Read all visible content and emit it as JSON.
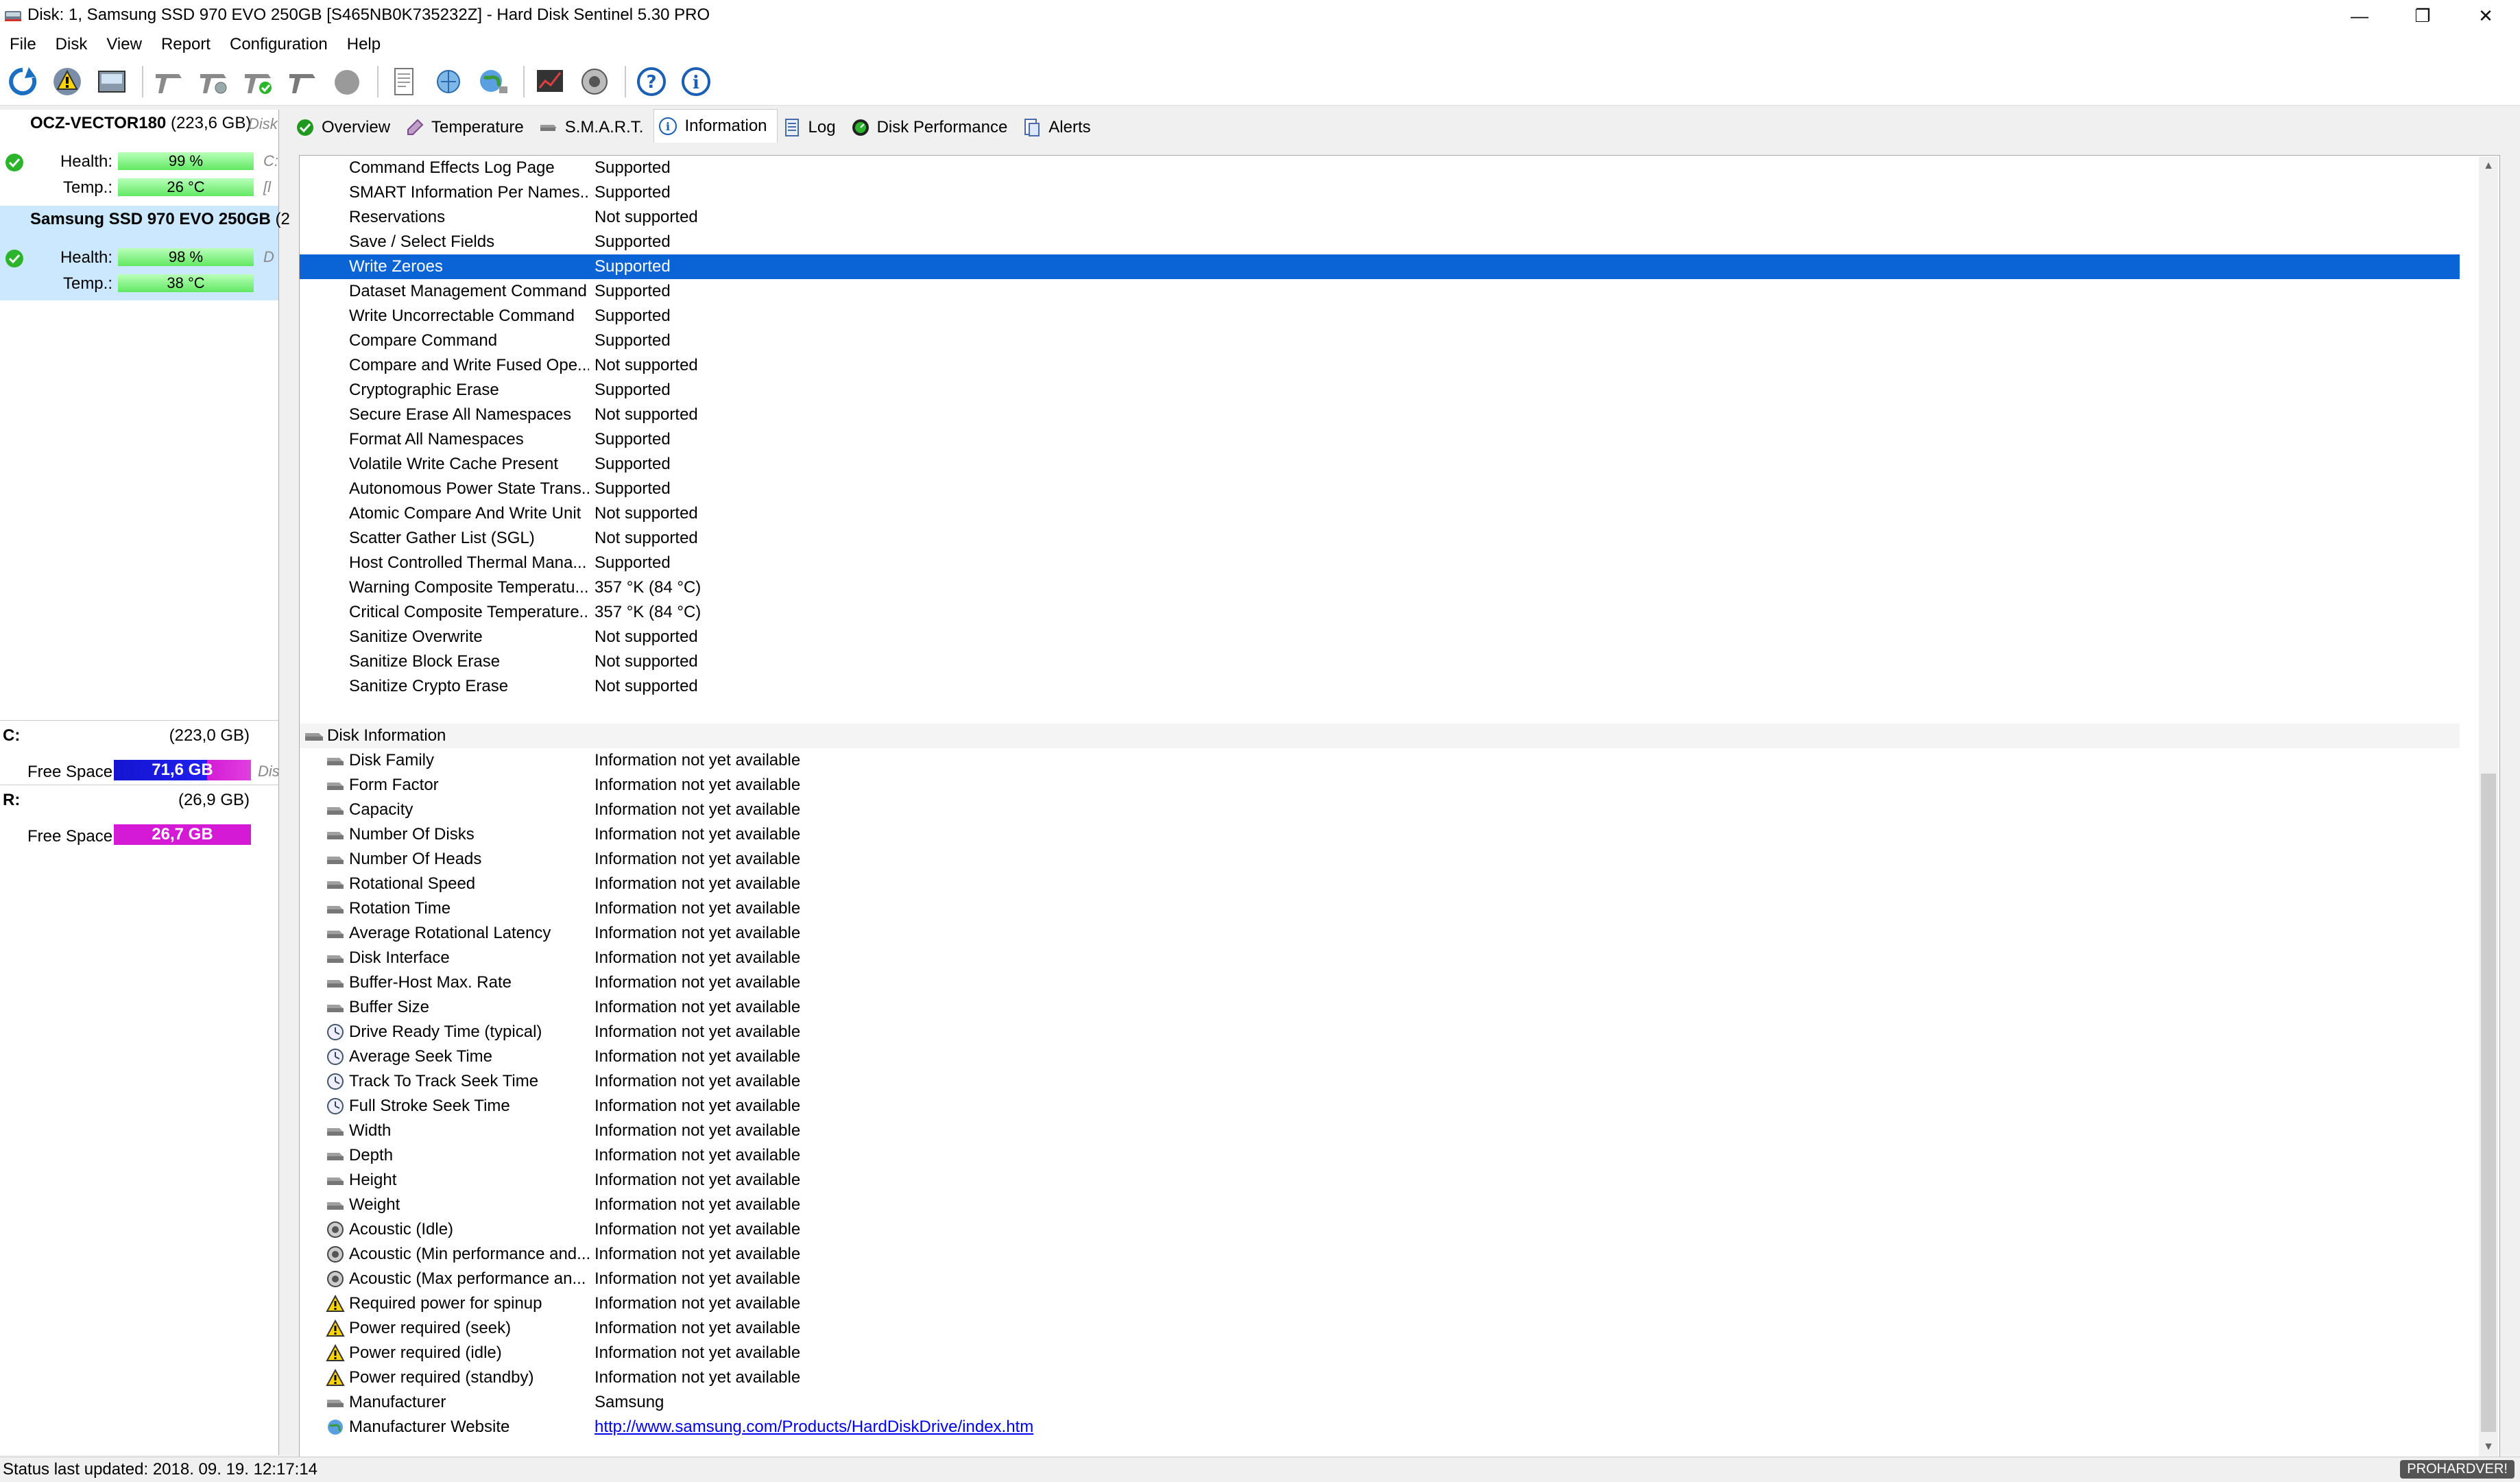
{
  "window": {
    "title": "Disk: 1, Samsung SSD 970 EVO 250GB [S465NB0K735232Z]  -  Hard Disk Sentinel 5.30 PRO",
    "minimize": "—",
    "restore": "❐",
    "close": "✕"
  },
  "menu": [
    "File",
    "Disk",
    "View",
    "Report",
    "Configuration",
    "Help"
  ],
  "disks": [
    {
      "name": "OCZ-VECTOR180",
      "size": "(223,6 GB)",
      "hint": "Disk",
      "health_label": "Health:",
      "health": "99 %",
      "health_hint": "C:",
      "temp_label": "Temp.:",
      "temp": "26 °C",
      "temp_hint": "[l"
    },
    {
      "name": "Samsung SSD 970 EVO 250GB",
      "size": "(2",
      "hint": "",
      "health_label": "Health:",
      "health": "98 %",
      "health_hint": "D",
      "temp_label": "Temp.:",
      "temp": "38 °C",
      "temp_hint": ""
    }
  ],
  "volumes": [
    {
      "letter": "C:",
      "size": "(223,0 GB)",
      "free_label": "Free Space",
      "free": "71,6 GB",
      "free_hint": "Dis",
      "color": "#1a1ad6"
    },
    {
      "letter": "R:",
      "size": "(26,9 GB)",
      "free_label": "Free Space",
      "free": "26,7 GB",
      "free_hint": "",
      "color": "#d41ad4"
    }
  ],
  "tabs": [
    "Overview",
    "Temperature",
    "S.M.A.R.T.",
    "Information",
    "Log",
    "Disk Performance",
    "Alerts"
  ],
  "features": [
    {
      "k": "Command Effects Log Page",
      "v": "Supported"
    },
    {
      "k": "SMART Information Per Names...",
      "v": "Supported"
    },
    {
      "k": "Reservations",
      "v": "Not supported"
    },
    {
      "k": "Save / Select Fields",
      "v": "Supported"
    },
    {
      "k": "Write Zeroes",
      "v": "Supported"
    },
    {
      "k": "Dataset Management Command",
      "v": "Supported"
    },
    {
      "k": "Write Uncorrectable Command",
      "v": "Supported"
    },
    {
      "k": "Compare Command",
      "v": "Supported"
    },
    {
      "k": "Compare and Write Fused Ope...",
      "v": "Not supported"
    },
    {
      "k": "Cryptographic Erase",
      "v": "Supported"
    },
    {
      "k": "Secure Erase All Namespaces",
      "v": "Not supported"
    },
    {
      "k": "Format All Namespaces",
      "v": "Supported"
    },
    {
      "k": "Volatile Write Cache Present",
      "v": "Supported"
    },
    {
      "k": "Autonomous Power State Trans...",
      "v": "Supported"
    },
    {
      "k": "Atomic Compare And Write Unit",
      "v": "Not supported"
    },
    {
      "k": "Scatter Gather List (SGL)",
      "v": "Not supported"
    },
    {
      "k": "Host Controlled Thermal Mana...",
      "v": "Supported"
    },
    {
      "k": "Warning Composite Temperatu...",
      "v": "357 °K (84 °C)"
    },
    {
      "k": "Critical Composite Temperature...",
      "v": "357 °K (84 °C)"
    },
    {
      "k": "Sanitize Overwrite",
      "v": "Not supported"
    },
    {
      "k": "Sanitize Block Erase",
      "v": "Not supported"
    },
    {
      "k": "Sanitize Crypto Erase",
      "v": "Not supported"
    }
  ],
  "disk_info_header": "Disk Information",
  "disk_info": [
    {
      "k": "Disk Family",
      "v": "Information not yet available",
      "icon": "disk"
    },
    {
      "k": "Form Factor",
      "v": "Information not yet available",
      "icon": "disk"
    },
    {
      "k": "Capacity",
      "v": "Information not yet available",
      "icon": "disk"
    },
    {
      "k": "Number Of Disks",
      "v": "Information not yet available",
      "icon": "disk"
    },
    {
      "k": "Number Of Heads",
      "v": "Information not yet available",
      "icon": "disk"
    },
    {
      "k": "Rotational Speed",
      "v": "Information not yet available",
      "icon": "disk"
    },
    {
      "k": "Rotation Time",
      "v": "Information not yet available",
      "icon": "disk"
    },
    {
      "k": "Average Rotational Latency",
      "v": "Information not yet available",
      "icon": "disk"
    },
    {
      "k": "Disk Interface",
      "v": "Information not yet available",
      "icon": "disk"
    },
    {
      "k": "Buffer-Host Max. Rate",
      "v": "Information not yet available",
      "icon": "disk"
    },
    {
      "k": "Buffer Size",
      "v": "Information not yet available",
      "icon": "disk"
    },
    {
      "k": "Drive Ready Time (typical)",
      "v": "Information not yet available",
      "icon": "clock"
    },
    {
      "k": "Average Seek Time",
      "v": "Information not yet available",
      "icon": "clock"
    },
    {
      "k": "Track To Track Seek Time",
      "v": "Information not yet available",
      "icon": "clock"
    },
    {
      "k": "Full Stroke Seek Time",
      "v": "Information not yet available",
      "icon": "clock"
    },
    {
      "k": "Width",
      "v": "Information not yet available",
      "icon": "disk"
    },
    {
      "k": "Depth",
      "v": "Information not yet available",
      "icon": "disk"
    },
    {
      "k": "Height",
      "v": "Information not yet available",
      "icon": "disk"
    },
    {
      "k": "Weight",
      "v": "Information not yet available",
      "icon": "disk"
    },
    {
      "k": "Acoustic (Idle)",
      "v": "Information not yet available",
      "icon": "speaker"
    },
    {
      "k": "Acoustic (Min performance and...",
      "v": "Information not yet available",
      "icon": "speaker"
    },
    {
      "k": "Acoustic (Max performance an...",
      "v": "Information not yet available",
      "icon": "speaker"
    },
    {
      "k": "Required power for spinup",
      "v": "Information not yet available",
      "icon": "warning"
    },
    {
      "k": "Power required (seek)",
      "v": "Information not yet available",
      "icon": "warning"
    },
    {
      "k": "Power required (idle)",
      "v": "Information not yet available",
      "icon": "warning"
    },
    {
      "k": "Power required (standby)",
      "v": "Information not yet available",
      "icon": "warning"
    },
    {
      "k": "Manufacturer",
      "v": "Samsung",
      "icon": "disk"
    },
    {
      "k": "Manufacturer Website",
      "v": "http://www.samsung.com/Products/HardDiskDrive/index.htm",
      "icon": "globe",
      "link": true
    }
  ],
  "selected_feature": "Write Zeroes",
  "status": "Status last updated: 2018. 09. 19. 12:17:14",
  "watermark": "PROHARDVER!",
  "colors": {
    "selection": "#0a64d6",
    "health_bar": "#62e862",
    "link": "#0000ee"
  }
}
